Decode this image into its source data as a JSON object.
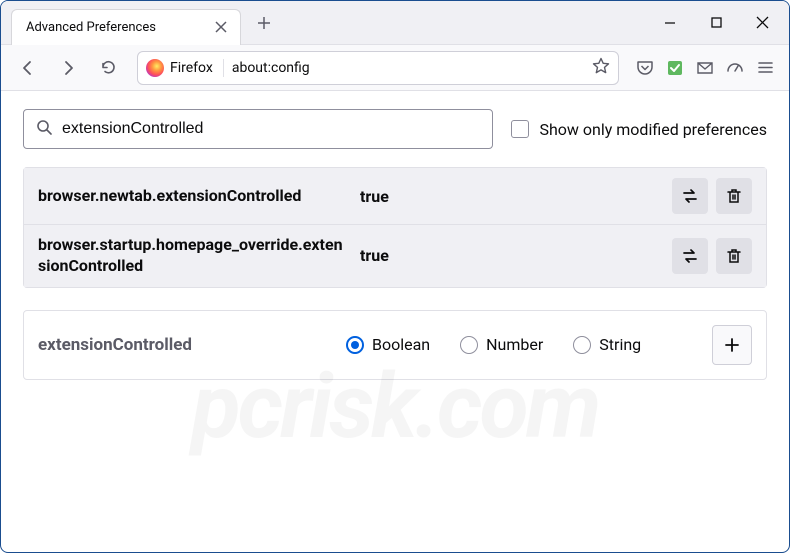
{
  "tab": {
    "title": "Advanced Preferences"
  },
  "urlbar": {
    "identity": "Firefox",
    "url": "about:config"
  },
  "search": {
    "value": "extensionControlled"
  },
  "checkbox": {
    "label": "Show only modified preferences"
  },
  "prefs": [
    {
      "name": "browser.newtab.extensionControlled",
      "value": "true"
    },
    {
      "name": "browser.startup.homepage_override.extensionControlled",
      "value": "true"
    }
  ],
  "newPref": {
    "name": "extensionControlled",
    "types": [
      "Boolean",
      "Number",
      "String"
    ],
    "selected": "Boolean"
  },
  "watermark": "pcrisk.com"
}
